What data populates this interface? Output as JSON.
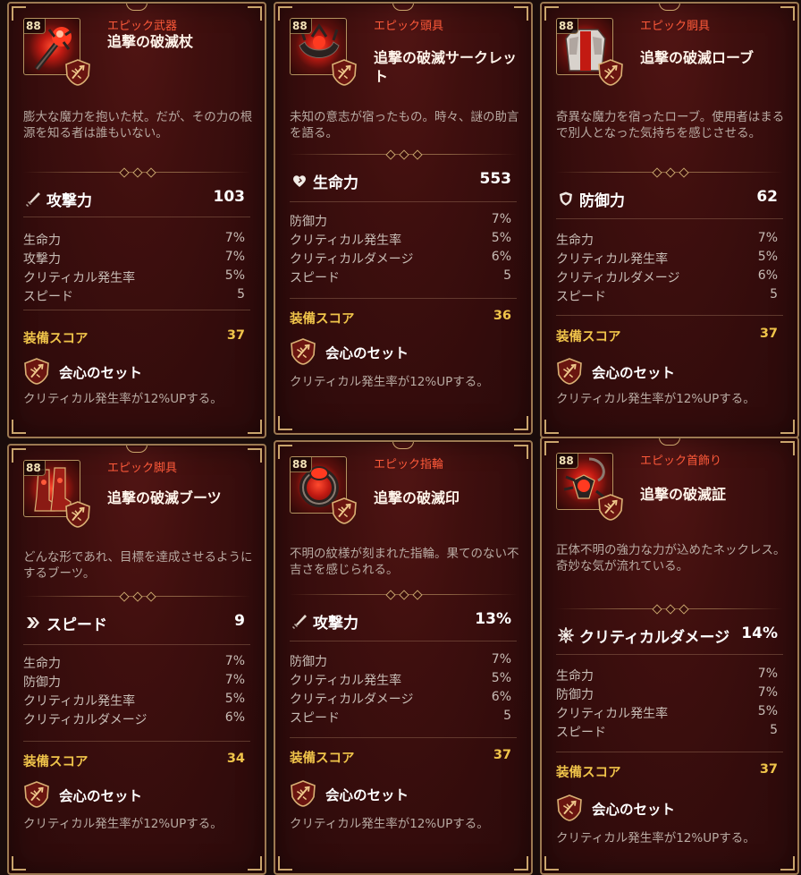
{
  "score_label": "装備スコア",
  "set": {
    "name": "会心のセット",
    "effect": "クリティカル発生率が12%UPする。"
  },
  "cards": [
    {
      "level": "88",
      "rarity": "エピック武器",
      "name": "追撃の破滅杖",
      "description": "膨大な魔力を抱いた杖。だが、その力の根源を知る者は誰もいない。",
      "main_stat": {
        "icon": "sword-icon",
        "label": "攻撃力",
        "value": "103"
      },
      "sub_stats": [
        {
          "label": "生命力",
          "value": "7%"
        },
        {
          "label": "攻撃力",
          "value": "7%"
        },
        {
          "label": "クリティカル発生率",
          "value": "5%"
        },
        {
          "label": "スピード",
          "value": "5"
        }
      ],
      "score": "37",
      "item_icon": "staff-icon"
    },
    {
      "level": "88",
      "rarity": "エピック頭具",
      "name": "追撃の破滅サークレット",
      "description": "未知の意志が宿ったもの。時々、謎の助言を語る。",
      "main_stat": {
        "icon": "heart-icon",
        "label": "生命力",
        "value": "553"
      },
      "sub_stats": [
        {
          "label": "防御力",
          "value": "7%"
        },
        {
          "label": "クリティカル発生率",
          "value": "5%"
        },
        {
          "label": "クリティカルダメージ",
          "value": "6%"
        },
        {
          "label": "スピード",
          "value": "5"
        }
      ],
      "score": "36",
      "item_icon": "circlet-icon"
    },
    {
      "level": "88",
      "rarity": "エピック胴具",
      "name": "追撃の破滅ローブ",
      "description": "奇異な魔力を宿ったローブ。使用者はまるで別人となった気持ちを感じさせる。",
      "main_stat": {
        "icon": "shield-icon",
        "label": "防御力",
        "value": "62"
      },
      "sub_stats": [
        {
          "label": "生命力",
          "value": "7%"
        },
        {
          "label": "クリティカル発生率",
          "value": "5%"
        },
        {
          "label": "クリティカルダメージ",
          "value": "6%"
        },
        {
          "label": "スピード",
          "value": "5"
        }
      ],
      "score": "37",
      "item_icon": "robe-icon"
    },
    {
      "level": "88",
      "rarity": "エピック脚具",
      "name": "追撃の破滅ブーツ",
      "description": "どんな形であれ、目標を達成させるようにするブーツ。",
      "main_stat": {
        "icon": "speed-icon",
        "label": "スピード",
        "value": "9"
      },
      "sub_stats": [
        {
          "label": "生命力",
          "value": "7%"
        },
        {
          "label": "防御力",
          "value": "7%"
        },
        {
          "label": "クリティカル発生率",
          "value": "5%"
        },
        {
          "label": "クリティカルダメージ",
          "value": "6%"
        }
      ],
      "score": "34",
      "item_icon": "boots-icon"
    },
    {
      "level": "88",
      "rarity": "エピック指輪",
      "name": "追撃の破滅印",
      "description": "不明の紋様が刻まれた指輪。果てのない不吉さを感じられる。",
      "main_stat": {
        "icon": "sword-icon",
        "label": "攻撃力",
        "value": "13%"
      },
      "sub_stats": [
        {
          "label": "防御力",
          "value": "7%"
        },
        {
          "label": "クリティカル発生率",
          "value": "5%"
        },
        {
          "label": "クリティカルダメージ",
          "value": "6%"
        },
        {
          "label": "スピード",
          "value": "5"
        }
      ],
      "score": "37",
      "item_icon": "ring-icon"
    },
    {
      "level": "88",
      "rarity": "エピック首飾り",
      "name": "追撃の破滅証",
      "description": "正体不明の強力な力が込めたネックレス。奇妙な気が流れている。",
      "main_stat": {
        "icon": "crit-damage-icon",
        "label": "クリティカルダメージ",
        "value": "14%"
      },
      "sub_stats": [
        {
          "label": "生命力",
          "value": "7%"
        },
        {
          "label": "防御力",
          "value": "7%"
        },
        {
          "label": "クリティカル発生率",
          "value": "5%"
        },
        {
          "label": "スピード",
          "value": "5"
        }
      ],
      "score": "37",
      "item_icon": "necklace-icon"
    }
  ]
}
